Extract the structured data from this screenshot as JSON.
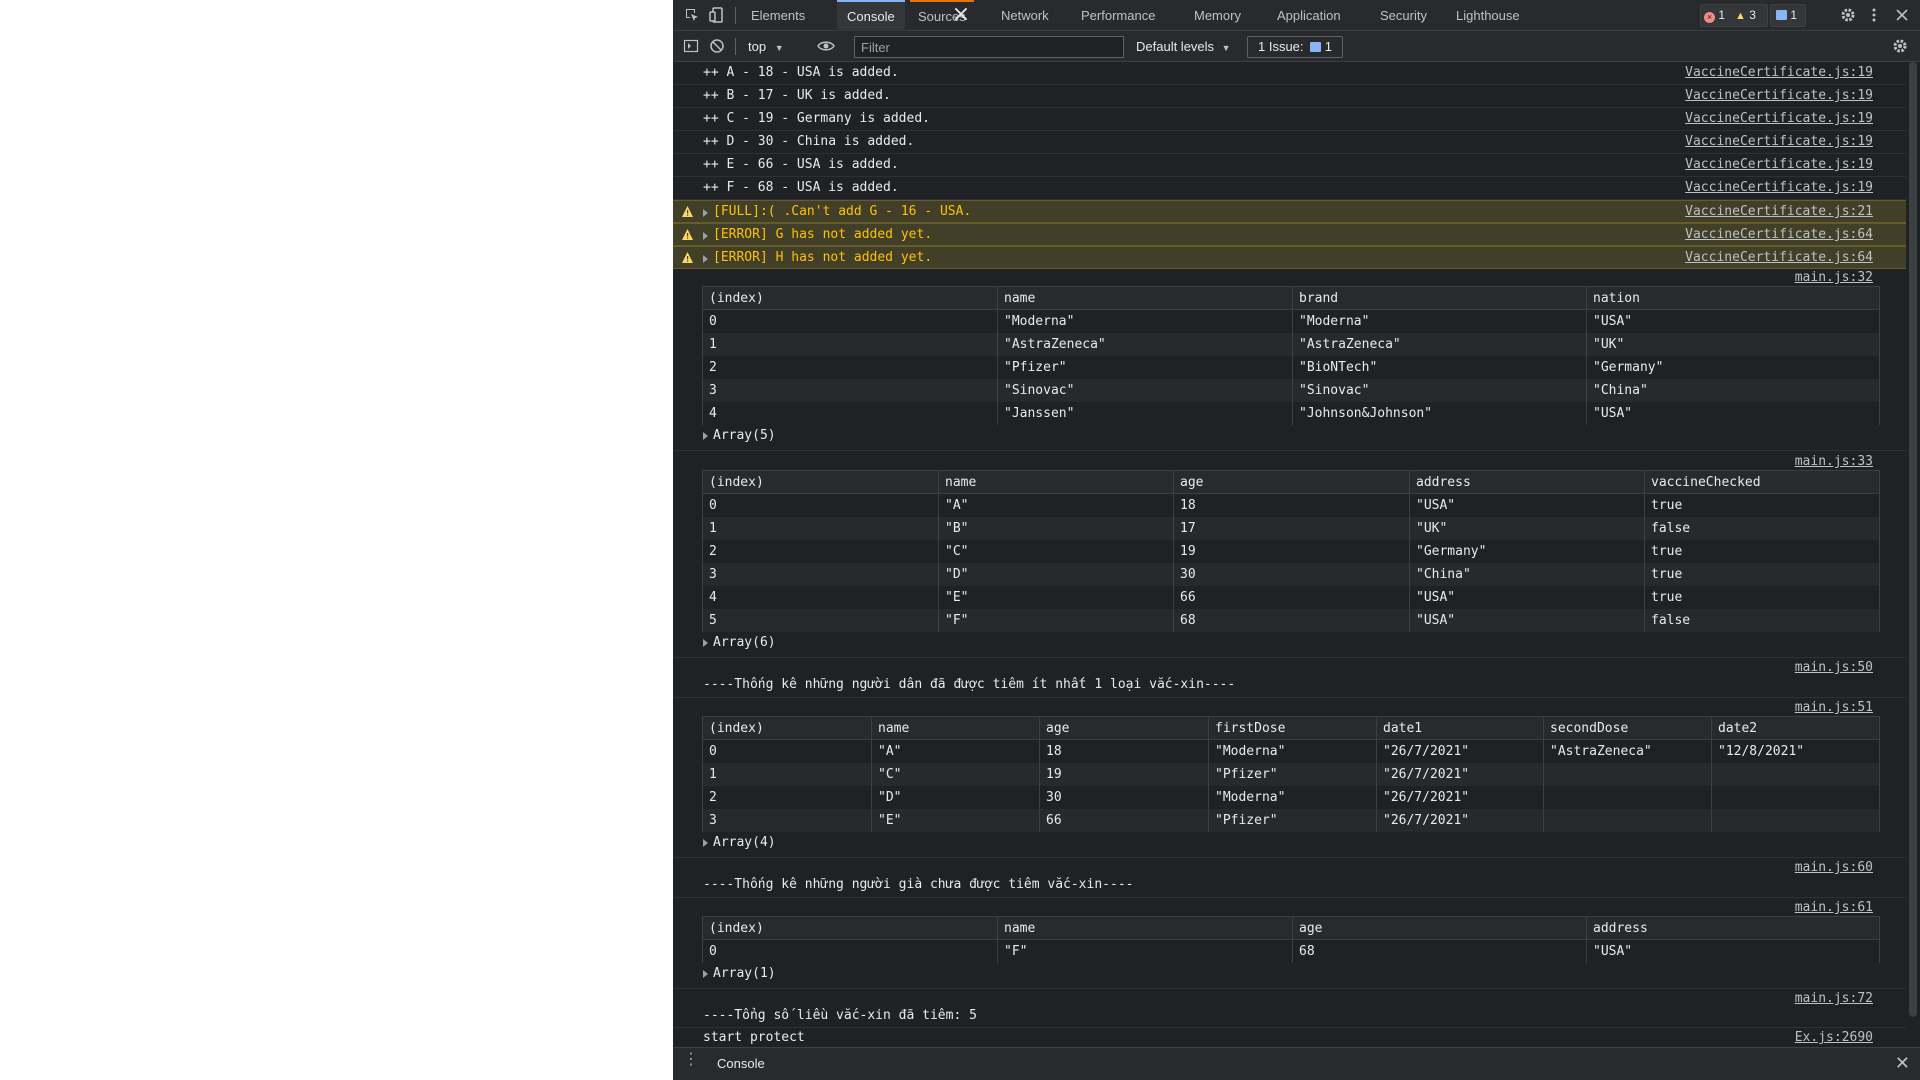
{
  "tabs": [
    "Elements",
    "Console",
    "Sources",
    "Network",
    "Performance",
    "Memory",
    "Application",
    "Security",
    "Lighthouse"
  ],
  "counts": {
    "errors": "1",
    "warnings": "3",
    "messages": "1"
  },
  "toolbar": {
    "context": "top",
    "filter_placeholder": "Filter",
    "levels": "Default levels",
    "issues_label": "1 Issue:",
    "issues_count": "1"
  },
  "logs": [
    {
      "text": "++ A - 18 - USA is added.",
      "source": "VaccineCertificate.js:19"
    },
    {
      "text": "++ B - 17 - UK is added.",
      "source": "VaccineCertificate.js:19"
    },
    {
      "text": "++ C - 19 - Germany is added.",
      "source": "VaccineCertificate.js:19"
    },
    {
      "text": "++ D - 30 - China is added.",
      "source": "VaccineCertificate.js:19"
    },
    {
      "text": "++ E - 66 - USA is added.",
      "source": "VaccineCertificate.js:19"
    },
    {
      "text": "++ F - 68 - USA is added.",
      "source": "VaccineCertificate.js:19"
    }
  ],
  "warnings": [
    {
      "text": "[FULL]:( .Can't add G - 16 - USA.",
      "source": "VaccineCertificate.js:21"
    },
    {
      "text": "[ERROR] G has not added yet.",
      "source": "VaccineCertificate.js:64"
    },
    {
      "text": "[ERROR] H has not added yet.",
      "source": "VaccineCertificate.js:64"
    }
  ],
  "table1": {
    "source": "main.js:32",
    "headers": [
      "(index)",
      "name",
      "brand",
      "nation"
    ],
    "rows": [
      [
        "0",
        "\"Moderna\"",
        "\"Moderna\"",
        "\"USA\""
      ],
      [
        "1",
        "\"AstraZeneca\"",
        "\"AstraZeneca\"",
        "\"UK\""
      ],
      [
        "2",
        "\"Pfizer\"",
        "\"BioNTech\"",
        "\"Germany\""
      ],
      [
        "3",
        "\"Sinovac\"",
        "\"Sinovac\"",
        "\"China\""
      ],
      [
        "4",
        "\"Janssen\"",
        "\"Johnson&Johnson\"",
        "\"USA\""
      ]
    ],
    "footer": "Array(5)"
  },
  "table2": {
    "source": "main.js:33",
    "headers": [
      "(index)",
      "name",
      "age",
      "address",
      "vaccineChecked"
    ],
    "rows": [
      [
        "0",
        "\"A\"",
        "18",
        "\"USA\"",
        "true"
      ],
      [
        "1",
        "\"B\"",
        "17",
        "\"UK\"",
        "false"
      ],
      [
        "2",
        "\"C\"",
        "19",
        "\"Germany\"",
        "true"
      ],
      [
        "3",
        "\"D\"",
        "30",
        "\"China\"",
        "true"
      ],
      [
        "4",
        "\"E\"",
        "66",
        "\"USA\"",
        "true"
      ],
      [
        "5",
        "\"F\"",
        "68",
        "\"USA\"",
        "false"
      ]
    ],
    "footer": "Array(6)"
  },
  "msg1": {
    "text": "----Thống kê những người dân đã được tiêm ít nhất 1 loại vắc-xin----",
    "source": "main.js:50"
  },
  "table3": {
    "source": "main.js:51",
    "headers": [
      "(index)",
      "name",
      "age",
      "firstDose",
      "date1",
      "secondDose",
      "date2"
    ],
    "rows": [
      [
        "0",
        "\"A\"",
        "18",
        "\"Moderna\"",
        "\"26/7/2021\"",
        "\"AstraZeneca\"",
        "\"12/8/2021\""
      ],
      [
        "1",
        "\"C\"",
        "19",
        "\"Pfizer\"",
        "\"26/7/2021\"",
        "",
        ""
      ],
      [
        "2",
        "\"D\"",
        "30",
        "\"Moderna\"",
        "\"26/7/2021\"",
        "",
        ""
      ],
      [
        "3",
        "\"E\"",
        "66",
        "\"Pfizer\"",
        "\"26/7/2021\"",
        "",
        ""
      ]
    ],
    "footer": "Array(4)"
  },
  "msg2": {
    "text": "----Thống kê những người già chưa được tiêm vắc-xin----",
    "source": "main.js:60"
  },
  "table4": {
    "source": "main.js:61",
    "headers": [
      "(index)",
      "name",
      "age",
      "address"
    ],
    "rows": [
      [
        "0",
        "\"F\"",
        "68",
        "\"USA\""
      ]
    ],
    "footer": "Array(1)"
  },
  "msg3": {
    "text": "----Tổng số liều vắc-xin đã tiêm: 5",
    "source": "main.js:72"
  },
  "msg4": {
    "text": "start protect",
    "source": "Ex.js:2690"
  },
  "drawer": {
    "tab": "Console"
  }
}
